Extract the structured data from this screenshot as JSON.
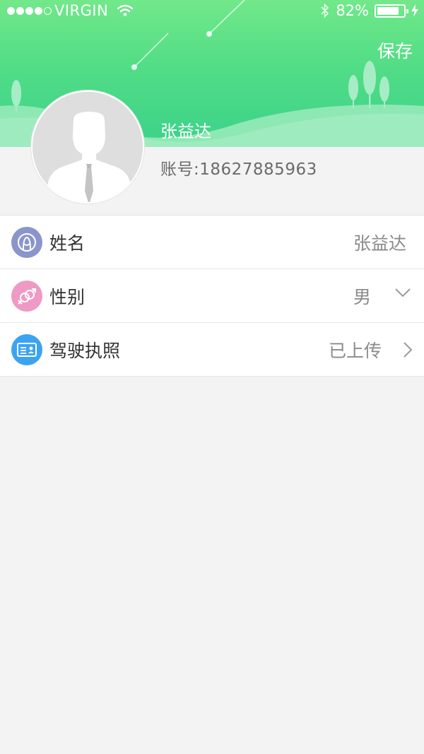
{
  "status_bar": {
    "carrier": "VIRGIN",
    "battery_text": "82%",
    "battery_level": 0.82
  },
  "header": {
    "save_label": "保存",
    "user_name": "张益达",
    "account_label": "账号:",
    "account_value": "18627885963"
  },
  "rows": [
    {
      "label": "姓名",
      "value": "张益达",
      "icon": "user-profile-icon",
      "icon_color": "#8a95cb"
    },
    {
      "label": "性别",
      "value": "男",
      "icon": "gender-icon",
      "icon_color": "#ee9ac4"
    },
    {
      "label": "驾驶执照",
      "value": "已上传",
      "icon": "license-card-icon",
      "icon_color": "#3ca3f0"
    }
  ],
  "colors": {
    "header_green": "#52dd86",
    "background": "#f3f3f3"
  }
}
